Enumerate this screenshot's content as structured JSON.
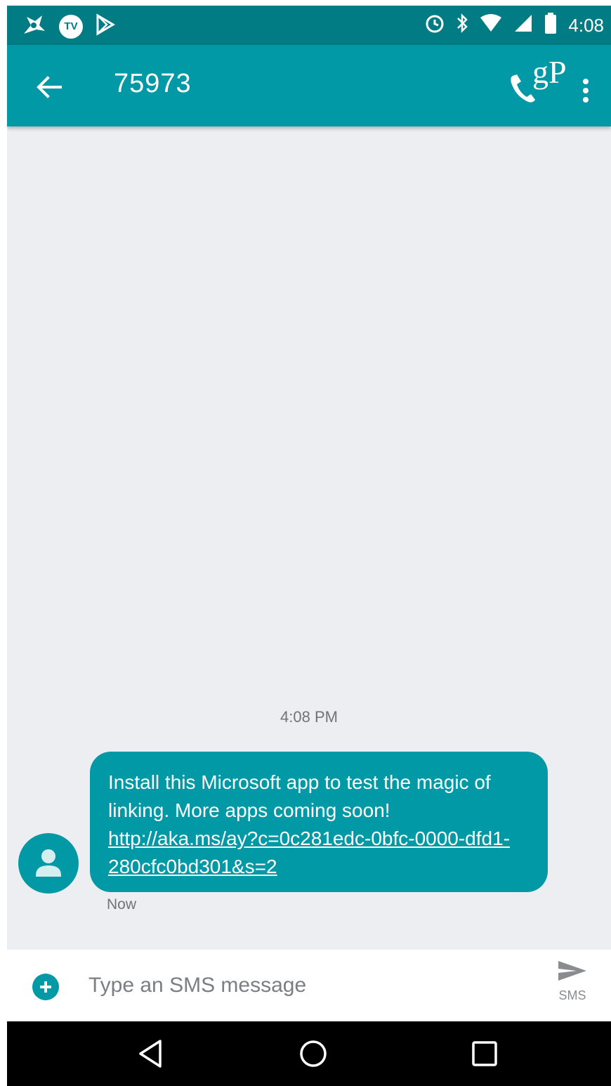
{
  "status_bar": {
    "tv_badge": "TV",
    "time": "4:08"
  },
  "app_bar": {
    "title": "75973",
    "brand_mark": "gP"
  },
  "conversation": {
    "timestamp": "4:08 PM",
    "messages": [
      {
        "text": "Install this Microsoft app to test the magic of linking. More apps coming soon! ",
        "link": "http://aka.ms/ay?c=0c281edc-0bfc-0000-dfd1-280cfc0bd301&s=2",
        "time": "Now"
      }
    ]
  },
  "composer": {
    "placeholder": "Type an SMS message",
    "send_label": "SMS"
  },
  "colors": {
    "status_bar": "#017b84",
    "app_bar": "#0199a5",
    "bubble": "#0199a5",
    "background": "#eceef1",
    "nav_bar": "#000000"
  },
  "icons": {
    "status_left": [
      "bug-icon",
      "tv-badge-icon",
      "play-store-icon"
    ],
    "status_right": [
      "alarm-icon",
      "bluetooth-icon",
      "wifi-icon",
      "cellular-signal-icon",
      "battery-icon"
    ],
    "app_bar": [
      "back-arrow-icon",
      "phone-icon",
      "more-vertical-icon"
    ],
    "composer": [
      "add-attachment-icon",
      "send-icon"
    ],
    "navigation": [
      "nav-back-icon",
      "nav-home-icon",
      "nav-recents-icon"
    ]
  }
}
